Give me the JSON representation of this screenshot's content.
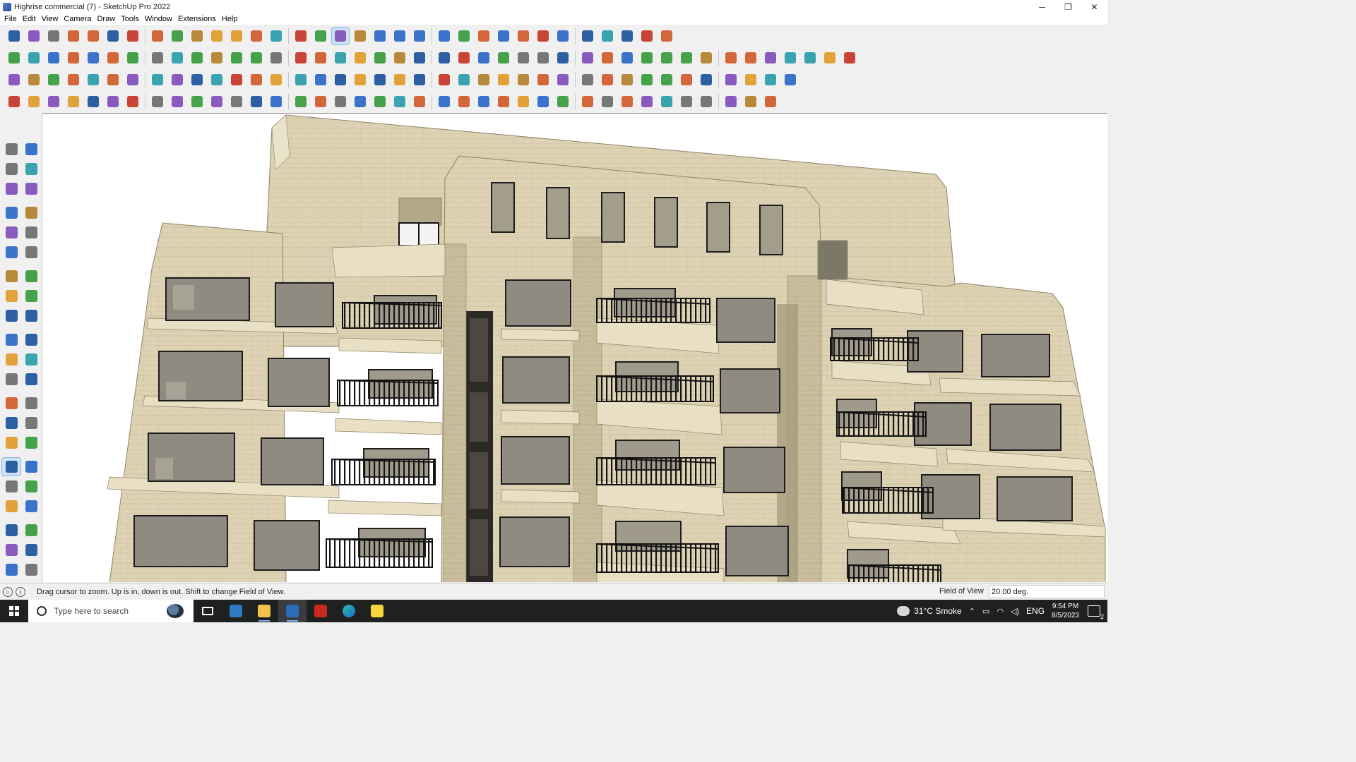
{
  "window": {
    "title": "Highrise commercial (7) - SketchUp Pro 2022",
    "controls": {
      "minimize": "─",
      "maximize": "❐",
      "close": "✕"
    }
  },
  "menu": [
    "File",
    "Edit",
    "View",
    "Camera",
    "Draw",
    "Tools",
    "Window",
    "Extensions",
    "Help"
  ],
  "toolbar_rows": {
    "row1": [
      "zoom-icon",
      "select-icon",
      "eraser-icon",
      "pencil-line-icon",
      "freehand-icon",
      "rectangle-icon",
      "push-pull-icon",
      "follow-me-icon",
      "move-icon",
      "rotate-icon",
      "scale-icon",
      "tape-measure-icon",
      "text-icon",
      "paint-bucket-icon",
      "orbit-icon",
      "pan-icon",
      "zoom-window-icon",
      "zoom-extents-icon",
      "3d-warehouse-icon",
      "extension-warehouse-icon",
      "layout-icon",
      "style-builder-icon",
      "user-account-icon",
      "sandbox-from-contours-icon",
      "sandbox-smoove-icon",
      "drape-icon",
      "flip-edge-icon",
      "stamp-icon",
      "add-detail-icon",
      "send-to-layout-icon",
      "undo-icon",
      "redo-icon",
      "clip-icon"
    ],
    "row2": [
      "iso-view-icon",
      "top-view-icon",
      "front-view-icon",
      "solid-union-icon",
      "solid-subtract-icon",
      "solid-intersect-icon",
      "solid-trim-icon",
      "solid-split-icon",
      "solid-outer-shell-icon",
      "follow-path-icon",
      "section-plane-icon",
      "section-display-icon",
      "section-cuts-icon",
      "surface-green-icon",
      "surface-texture-icon",
      "house-icon",
      "house-outline-icon",
      "barn-icon",
      "home-icon",
      "garage-icon",
      "function-graph-icon",
      "sketch-hand-icon",
      "paint-brush-icon",
      "ellipse-icon",
      "circle-icon",
      "hexagon-icon",
      "oval-icon",
      "parallelogram-icon",
      "lasso-icon",
      "arc-icon",
      "spiral-icon",
      "curve-icon",
      "shape-offset-icon",
      "arrow-red-icon",
      "eraser-pink-icon",
      "brick-icon",
      "grid-texture-icon",
      "material-icon",
      "terrain-icon",
      "mesh-icon",
      "panel-icon",
      "roof-icon"
    ],
    "row3": [
      "blue-cube-icon",
      "blue-plane-icon",
      "yellow-plane-icon",
      "green-plane-icon",
      "red-plane-icon",
      "sheet-icon",
      "orange-hook-icon",
      "red-square-icon",
      "stair-icon",
      "curtain-icon",
      "cube-orange-icon",
      "link-icon",
      "pipe-icon",
      "bezier-icon",
      "cross-red-icon",
      "cross-green-icon",
      "x-blue-icon",
      "cone-icon",
      "cone-green-icon",
      "triangle-icon",
      "loop-icon",
      "knot-icon",
      "swirl-icon",
      "star-icon",
      "box-icon",
      "hook-red-icon",
      "green-pieces-icon",
      "shape-3d-icon",
      "red-gear-icon",
      "stacked-boxes-icon",
      "gem-icon",
      "rings-icon",
      "window-frame-icon",
      "grid-orange-icon",
      "grid-orange2-icon",
      "tile-icon",
      "scatter-icon",
      "dots-curve-icon",
      "qr-icon"
    ],
    "row4": [
      "segment-icon",
      "bezier-curve-icon",
      "car-icon",
      "pliers-icon",
      "gear-outline-icon",
      "shoe-icon",
      "tube-bend-icon",
      "box-outline-icon",
      "globe-icon",
      "stair-twist-icon",
      "line-bend-icon",
      "line-step-icon",
      "line-red-icon",
      "arc-red-icon",
      "bridge-icon",
      "wedge-icon",
      "comb-icon",
      "ridge-icon",
      "hand-icon",
      "leaf-icon",
      "leaf-split-icon",
      "fin-icon",
      "slat-icon",
      "feather-icon",
      "fishbone-icon",
      "stamp-gray-icon",
      "diagonal-icon",
      "bracket-icon",
      "column-icon",
      "truss-icon",
      "crosshatch-icon",
      "louver-icon",
      "grill-icon",
      "fan-icon",
      "star-burst-icon",
      "ribs-icon",
      "comb2-icon",
      "cube-gray-icon"
    ]
  },
  "palette": [
    "select-arrow-icon",
    "orbit-cross-icon",
    "paint-bucket-icon",
    "eraser-icon",
    "component-icon",
    "tape-icon",
    "pencil-icon",
    "freehand-icon",
    "rectangle-icon",
    "rotated-rectangle-icon",
    "circle-icon",
    "polygon-icon",
    "arc-icon",
    "two-point-arc-icon",
    "three-point-arc-icon",
    "pie-icon",
    "move-icon",
    "push-pull-icon",
    "rotate-icon",
    "follow-me-icon",
    "scale-icon",
    "offset-icon",
    "tape-measure-icon",
    "dimension-icon",
    "protractor-icon",
    "text-3d-icon",
    "axes-icon",
    "3d-text-icon",
    "orbit-icon",
    "pan-icon",
    "zoom-icon",
    "zoom-window-icon",
    "zoom-extents-icon",
    "previous-view-icon",
    "position-camera-icon",
    "look-around-icon",
    "walk-icon",
    "section-plane-icon",
    "warehouse-icon",
    "extension-icon",
    "layers-icon",
    "sandbox-icon"
  ],
  "statusbar": {
    "message": "Drag cursor to zoom.  Up is in, down is out. Shift to change Field of View.",
    "fov_label": "Field of View",
    "fov_value": "20.00 deg."
  },
  "taskbar": {
    "search_placeholder": "Type here to search",
    "apps": [
      "task-view-icon",
      "calculator-icon",
      "file-explorer-icon",
      "sketchup-icon",
      "acrobat-icon",
      "edge-icon",
      "sticky-notes-icon"
    ],
    "weather": "31°C  Smoke",
    "lang": "ENG",
    "time": "9:54 PM",
    "date": "8/5/2023",
    "notifications": "2"
  },
  "colors": {
    "stone": "#ddd2b4",
    "stone_shadow": "#b9ae90",
    "window_glass": "#8f8b80",
    "railing": "#111111",
    "selection_blue": "#cfe3f7"
  }
}
